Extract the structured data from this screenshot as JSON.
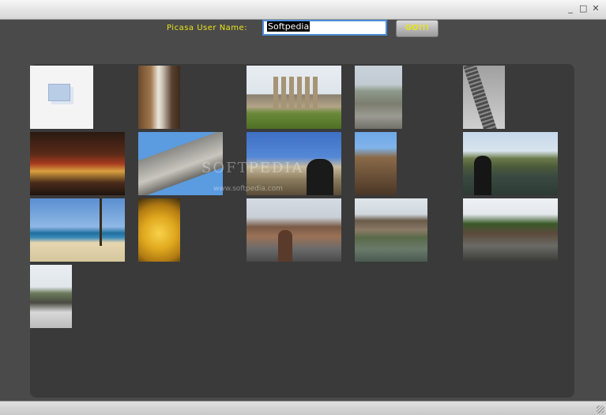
{
  "window": {
    "controls": {
      "minimize": "_",
      "maximize": "□",
      "close": "✕"
    }
  },
  "toolbar": {
    "user_label": "Picasa User Name:",
    "username_value": "Softpedia",
    "go_label": "GO!!!"
  },
  "watermark": {
    "text": "SOFTPEDIA",
    "url": "www.softpedia.com"
  },
  "colors": {
    "accent_yellow": "#e8e41a",
    "background": "#4a4a4a",
    "panel": "#3a3a3a"
  }
}
